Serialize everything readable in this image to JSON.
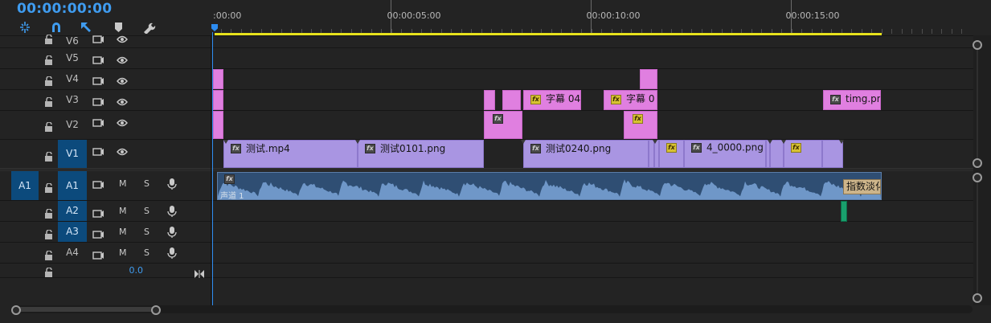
{
  "timecode": "00:00:00:00",
  "toolbar": {
    "icons": [
      "snap-insert-icon",
      "magnet-snap-icon",
      "linked-selection-icon",
      "marker-icon",
      "wrench-settings-icon"
    ]
  },
  "ruler": {
    "labels": [
      ":00:00",
      "00:00:05:00",
      "00:00:10:00",
      "00:00:15:00"
    ]
  },
  "tracks": {
    "video": [
      {
        "label": "V6"
      },
      {
        "label": "V5"
      },
      {
        "label": "V4"
      },
      {
        "label": "V3"
      },
      {
        "label": "V2"
      },
      {
        "label": "V1"
      }
    ],
    "audio": [
      {
        "label": "A1",
        "source": "A1",
        "m": "M",
        "s": "S"
      },
      {
        "label": "A2",
        "source": "A2",
        "m": "M",
        "s": "S"
      },
      {
        "label": "A3",
        "source": "A3",
        "m": "M",
        "s": "S"
      },
      {
        "label": "A4",
        "source": "",
        "m": "M",
        "s": "S"
      }
    ],
    "master_volume": "0.0"
  },
  "clips": {
    "v3": [
      "字幕 04",
      "字幕 0",
      "timg.png"
    ],
    "v1": [
      "测试.mp4",
      "测试0101.png",
      "测试0240.png",
      "4_0000.png"
    ],
    "fx": "fx",
    "audio_label": "声道 1",
    "audio_transition": "指数淡化"
  },
  "colors": {
    "accent": "#3f9cf0",
    "work_area": "#e7e21d",
    "graphics_clip": "#e07fe0",
    "video_clip": "#a995e2",
    "audio_clip": "#2f4e73",
    "target_track": "#0c4a7c"
  }
}
